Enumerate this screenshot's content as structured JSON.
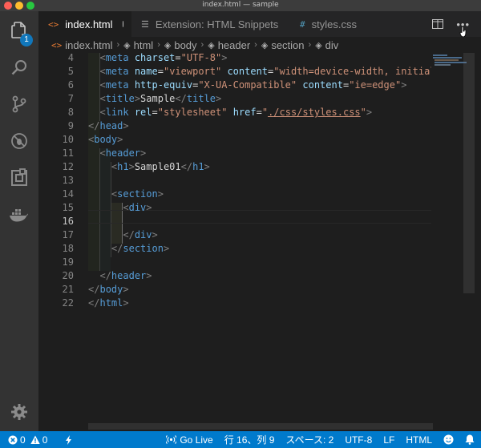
{
  "window": {
    "title": "index.html — sample"
  },
  "activity_bar": {
    "items": [
      "files-icon",
      "search-icon",
      "source-control-icon",
      "debug-icon",
      "extensions-icon",
      "docker-icon"
    ],
    "explorer_badge": "1",
    "settings_icon": "gear-icon"
  },
  "tabs": [
    {
      "icon": "<>",
      "label": "index.html",
      "dirty": true
    },
    {
      "icon": "☰",
      "label": "Extension: HTML Snippets"
    },
    {
      "icon": "#",
      "label": "styles.css"
    }
  ],
  "breadcrumb": {
    "file": "index.html",
    "items": [
      "html",
      "body",
      "header",
      "section",
      "div"
    ]
  },
  "editor": {
    "current_line": 16,
    "lines": [
      {
        "n": "4",
        "text": "    <meta charset=\"UTF-8\">"
      },
      {
        "n": "5",
        "text": "    <meta name=\"viewport\" content=\"width=device-width, initial-sc"
      },
      {
        "n": "6",
        "text": "    <meta http-equiv=\"X-UA-Compatible\" content=\"ie=edge\">"
      },
      {
        "n": "7",
        "text": "    <title>Sample</title>"
      },
      {
        "n": "8",
        "text": "    <link rel=\"stylesheet\" href=\"./css/styles.css\">"
      },
      {
        "n": "9",
        "text": "</head>"
      },
      {
        "n": "10",
        "text": "<body>"
      },
      {
        "n": "11",
        "text": "    <header>"
      },
      {
        "n": "12",
        "text": "        <h1>Sample01</h1>"
      },
      {
        "n": "13",
        "text": ""
      },
      {
        "n": "14",
        "text": "        <section>"
      },
      {
        "n": "15",
        "text": "            <div>"
      },
      {
        "n": "16",
        "text": ""
      },
      {
        "n": "17",
        "text": "            </div>"
      },
      {
        "n": "18",
        "text": "        </section>"
      },
      {
        "n": "19",
        "text": ""
      },
      {
        "n": "20",
        "text": "    </header>"
      },
      {
        "n": "21",
        "text": "</body>"
      },
      {
        "n": "22",
        "text": "</html>"
      }
    ]
  },
  "status_bar": {
    "errors": "0",
    "warnings": "0",
    "go_live": "Go Live",
    "position": "行 16、列 9",
    "spaces": "スペース: 2",
    "encoding": "UTF-8",
    "eol": "LF",
    "language": "HTML"
  },
  "colors": {
    "status_bar": "#007acc",
    "tag": "#569cd6",
    "attribute": "#9cdcfe",
    "string": "#ce9178"
  }
}
